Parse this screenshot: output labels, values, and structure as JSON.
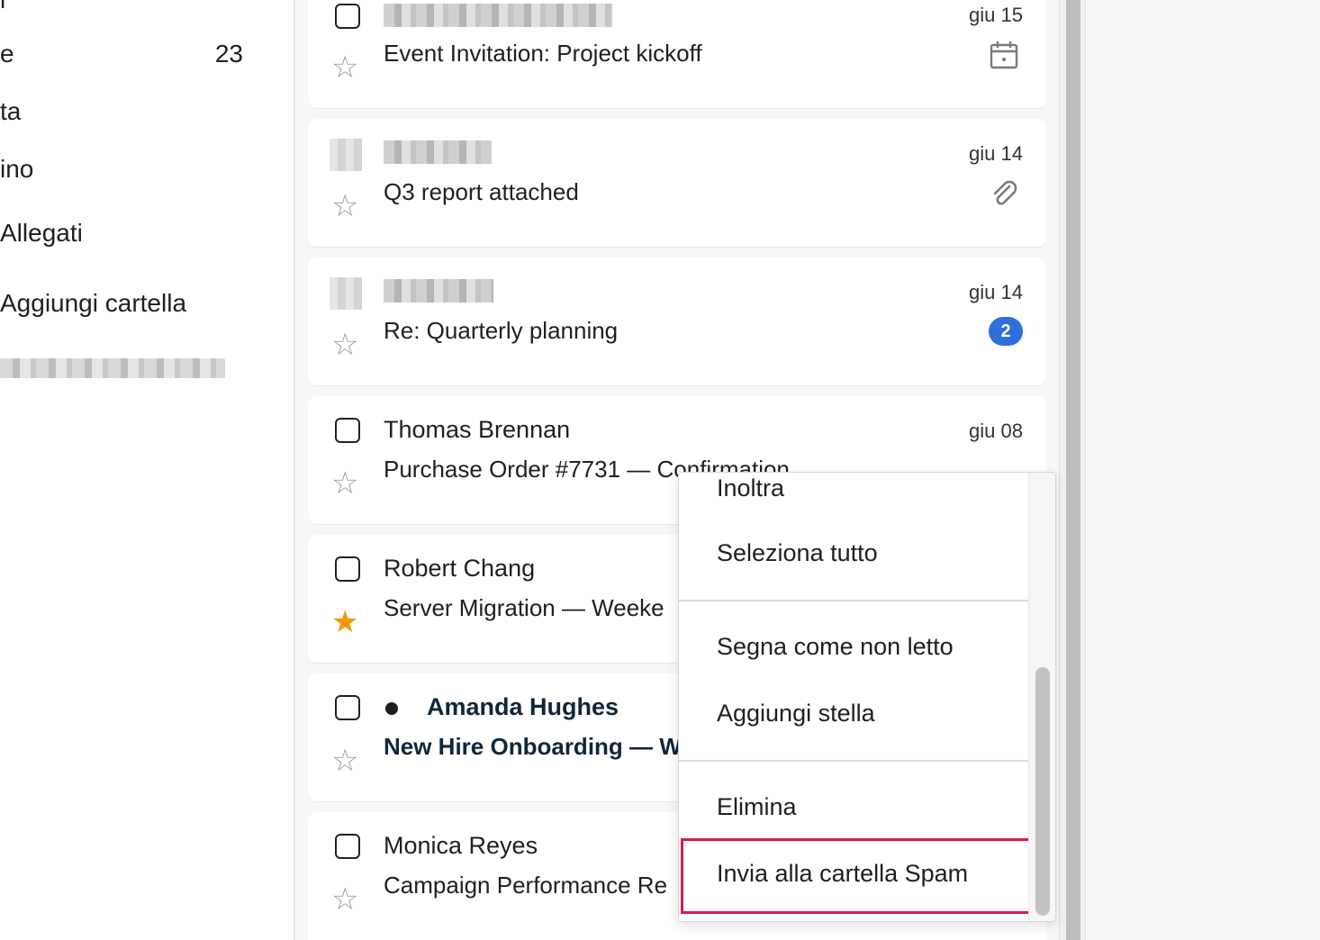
{
  "sidebar": {
    "items": [
      {
        "label": "e",
        "count": "23"
      },
      {
        "label": "ta"
      },
      {
        "label": "ino"
      },
      {
        "label": "Allegati"
      },
      {
        "label": "Aggiungi cartella"
      }
    ],
    "top_fragment": "l"
  },
  "emails": [
    {
      "subject": "Event Invitation: Project kickoff",
      "date": "giu 15",
      "icon": "calendar-icon",
      "starred": false
    },
    {
      "subject": "Q3 report attached",
      "date": "giu 14",
      "icon": "paperclip-icon",
      "starred": false
    },
    {
      "subject": "Re: Quarterly planning",
      "date": "giu 14",
      "badge": "2",
      "starred": false
    },
    {
      "sender": "Thomas Brennan",
      "subject": "Purchase Order #7731 — Confirmation",
      "date": "giu 08",
      "starred": false
    },
    {
      "sender": "Robert Chang",
      "subject": "Server Migration — Weeke",
      "starred": true
    },
    {
      "sender": "Amanda Hughes",
      "subject": "New Hire Onboarding — W",
      "unread": true,
      "starred": false
    },
    {
      "sender": "Monica Reyes",
      "subject": "Campaign Performance Re",
      "starred": false
    }
  ],
  "context_menu": {
    "items": [
      "Inoltra",
      "Seleziona tutto",
      "Segna come non letto",
      "Aggiungi stella",
      "Elimina",
      "Invia alla cartella Spam"
    ],
    "highlighted": "Invia alla cartella Spam"
  },
  "colors": {
    "accent": "#2f6fdb",
    "star": "#f29900",
    "highlight": "#d81b4a"
  }
}
